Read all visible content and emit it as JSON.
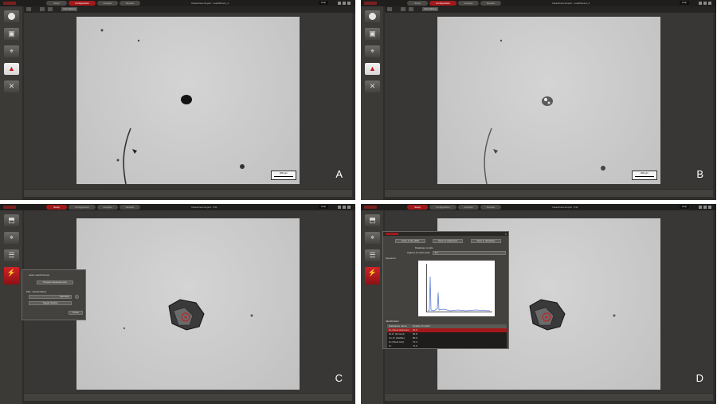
{
  "panels": [
    {
      "letter": "A",
      "window_title": "Cleanliness Expert - LoadSheet1_1",
      "tabs": [
        "Setup",
        "Configuration",
        "Analysis",
        "Results"
      ],
      "active_tab": 1,
      "help": "Help",
      "toolbar_label": "Normalized",
      "scale_bar": "200 µm"
    },
    {
      "letter": "B",
      "window_title": "Cleanliness Expert - LoadSheet1_2",
      "tabs": [
        "Setup",
        "Configuration",
        "Analysis",
        "Results"
      ],
      "active_tab": 1,
      "help": "Help",
      "toolbar_label": "Normalized",
      "scale_bar": "200 µm"
    },
    {
      "letter": "C",
      "window_title": "Cleanliness Expert - 011",
      "tabs": [
        "Setup",
        "Configuration",
        "Analysis",
        "Results"
      ],
      "active_tab": 0,
      "help": "Help",
      "dialog": {
        "title": "Laser spectroscopy",
        "prepare_button": "Prepare Measurement",
        "field_label": "Max. shutters/laser",
        "field_value": "Standard",
        "toggle_button": "Toggle Shutter",
        "close_button": "Close"
      }
    },
    {
      "letter": "D",
      "window_title": "Cleanliness Expert - 011",
      "tabs": [
        "Setup",
        "Configuration",
        "Analysis",
        "Results"
      ],
      "active_tab": 0,
      "help": "Help",
      "dialog": {
        "buttons": [
          "Save to file (DB)",
          "Save to Clipboard",
          "Start in database"
        ],
        "database_label": "Database results",
        "limit_label": "Highest # match data",
        "limit_value": "10",
        "spectrum_label": "Spectrum",
        "results_label": "Identification",
        "table_headers": [
          "Substance name",
          "Quality of match"
        ],
        "table_rows": [
          [
            "Fe (Steel,stainless)",
            "92.0"
          ],
          [
            "Ni-Cr (Inconel)",
            "81.8"
          ],
          [
            "Co-Cr (Stellite)",
            "80.9"
          ],
          [
            "Fe (Steel,tool)",
            "74.4"
          ],
          [
            "Cr",
            "71.6"
          ]
        ]
      }
    }
  ],
  "colors": {
    "active_tab": "#a3191b",
    "window_bg": "#2e2d2b",
    "spectrum_line": "#5b7bd5"
  }
}
